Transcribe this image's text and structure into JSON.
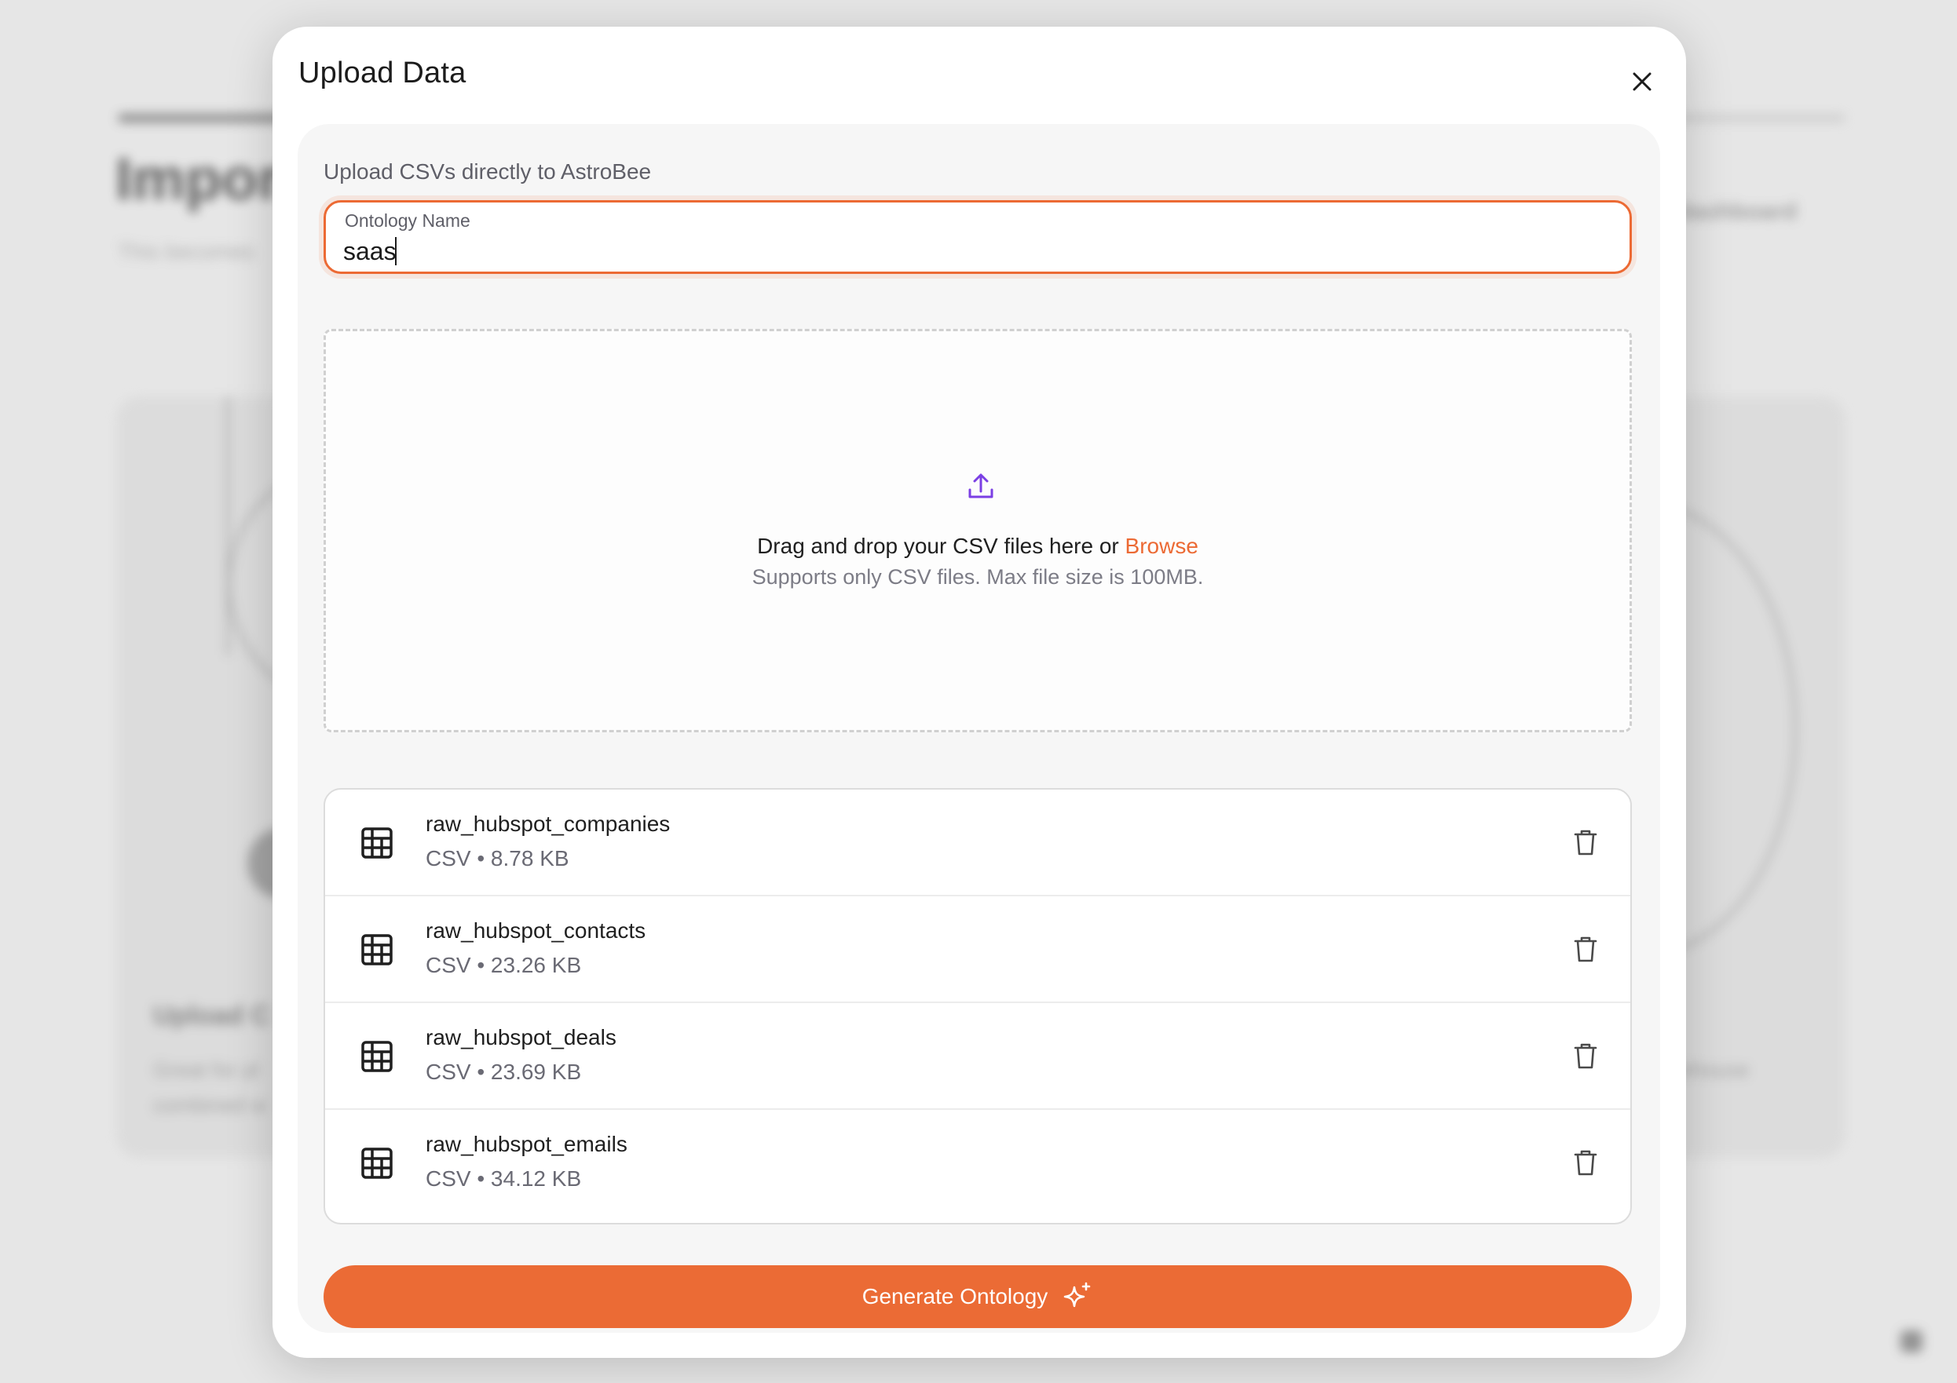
{
  "background": {
    "heading": "Impor",
    "subtitle": "This becomes",
    "link": "dashboard",
    "card_title": "Upload C",
    "card_text_line1": "Great for pl",
    "card_text_line2": "combined w",
    "right_card_text": "rehouse"
  },
  "modal": {
    "title": "Upload Data",
    "close_icon": "close-icon",
    "panel_label": "Upload CSVs directly to AstroBee",
    "ontology_field": {
      "label": "Ontology Name",
      "value": "saas",
      "accent": "#ec6a34"
    },
    "dropzone": {
      "icon": "upload-icon",
      "prompt": "Drag and drop your CSV files here or ",
      "browse_label": "Browse",
      "hint": "Supports only CSV files. Max file size is 100MB."
    },
    "files": [
      {
        "name": "raw_hubspot_companies",
        "meta": "CSV • 8.78 KB"
      },
      {
        "name": "raw_hubspot_contacts",
        "meta": "CSV • 23.26 KB"
      },
      {
        "name": "raw_hubspot_deals",
        "meta": "CSV • 23.69 KB"
      },
      {
        "name": "raw_hubspot_emails",
        "meta": "CSV • 34.12 KB"
      }
    ],
    "generate_button": {
      "label": "Generate Ontology",
      "icon": "sparkle-icon",
      "color": "#eb6b35"
    }
  }
}
